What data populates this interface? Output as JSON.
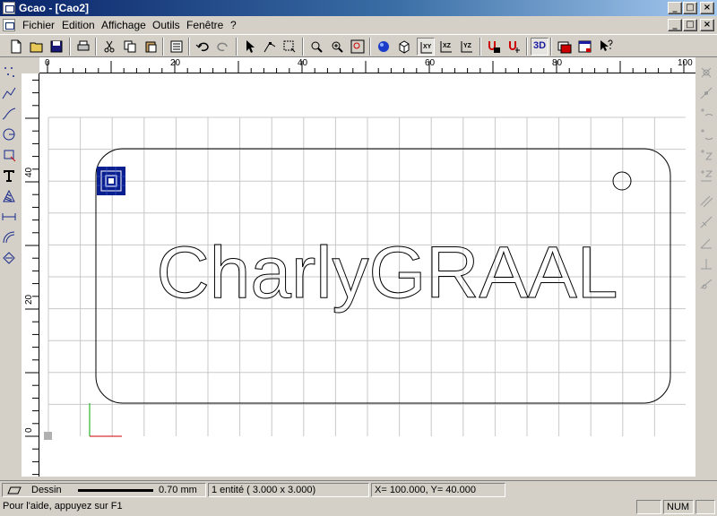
{
  "window": {
    "title": "Gcao - [Cao2]",
    "buttons": {
      "minimize": "_",
      "maximize": "□",
      "close": "×"
    }
  },
  "menu": {
    "items": [
      "Fichier",
      "Edition",
      "Affichage",
      "Outils",
      "Fenêtre",
      "?"
    ]
  },
  "toolbar": {
    "view_3d_label": "3D",
    "view_xy": "XY",
    "view_xz": "XZ",
    "view_yz": "YZ"
  },
  "ruler": {
    "h_labels": [
      "0",
      "20",
      "40",
      "60",
      "80",
      "100"
    ],
    "v_labels": [
      "40",
      "20",
      "0"
    ]
  },
  "drawing": {
    "text": "CharlyGRAAL"
  },
  "status": {
    "layer": "Dessin",
    "line_width": "0.70 mm",
    "selection": "1 entité  (    3.000 x     3.000)",
    "coords": "X=  100.000, Y=    40.000",
    "help": "Pour l'aide, appuyez sur F1",
    "num": "NUM"
  },
  "colors": {
    "title_start": "#0a246a",
    "title_end": "#a6caf0",
    "grid": "#c8c8c8",
    "axis_x": "#cc0000",
    "axis_y": "#00aa00",
    "marker": "#0a1f8f"
  }
}
